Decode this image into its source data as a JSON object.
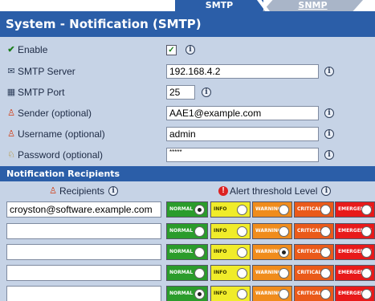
{
  "tabs": [
    {
      "label": "SMTP",
      "active": true
    },
    {
      "label": "SNMP",
      "active": false
    }
  ],
  "page_title": "System - Notification (SMTP)",
  "form": {
    "enable": {
      "label": "Enable",
      "checked": true
    },
    "smtp_server": {
      "label": "SMTP Server",
      "value": "192.168.4.2"
    },
    "smtp_port": {
      "label": "SMTP Port",
      "value": "25"
    },
    "sender": {
      "label": "Sender (optional)",
      "value": "AAE1@example.com"
    },
    "username": {
      "label": "Username (optional)",
      "value": "admin"
    },
    "password": {
      "label": "Password (optional)",
      "value": "*****"
    }
  },
  "recipients_section": {
    "title": "Notification Recipients",
    "col_recipients": "Recipients",
    "col_alert": "Alert threshold Level",
    "levels": [
      "NORMAL",
      "INFO",
      "WARNING",
      "CRITICAL",
      "EMERGENCY"
    ],
    "rows": [
      {
        "email": "croyston@software.example.com",
        "selected": "NORMAL"
      },
      {
        "email": "",
        "selected": ""
      },
      {
        "email": "",
        "selected": "WARNING"
      },
      {
        "email": "",
        "selected": ""
      },
      {
        "email": "",
        "selected": "NORMAL"
      }
    ]
  },
  "colors": {
    "brand_blue": "#2b5ea8",
    "background": "#c6d3e6",
    "normal": "#2b9c2b",
    "info": "#f0ec2a",
    "warning": "#f08c1c",
    "critical": "#ea5a1a",
    "emergency": "#e81a1a"
  },
  "icons": {
    "enable": "checkmark-icon",
    "smtp_server": "envelope-icon",
    "smtp_port": "grid-icon",
    "sender": "user-icon",
    "username": "user-icon",
    "password": "lock-user-icon",
    "alert": "alert-icon",
    "info": "info-icon"
  }
}
